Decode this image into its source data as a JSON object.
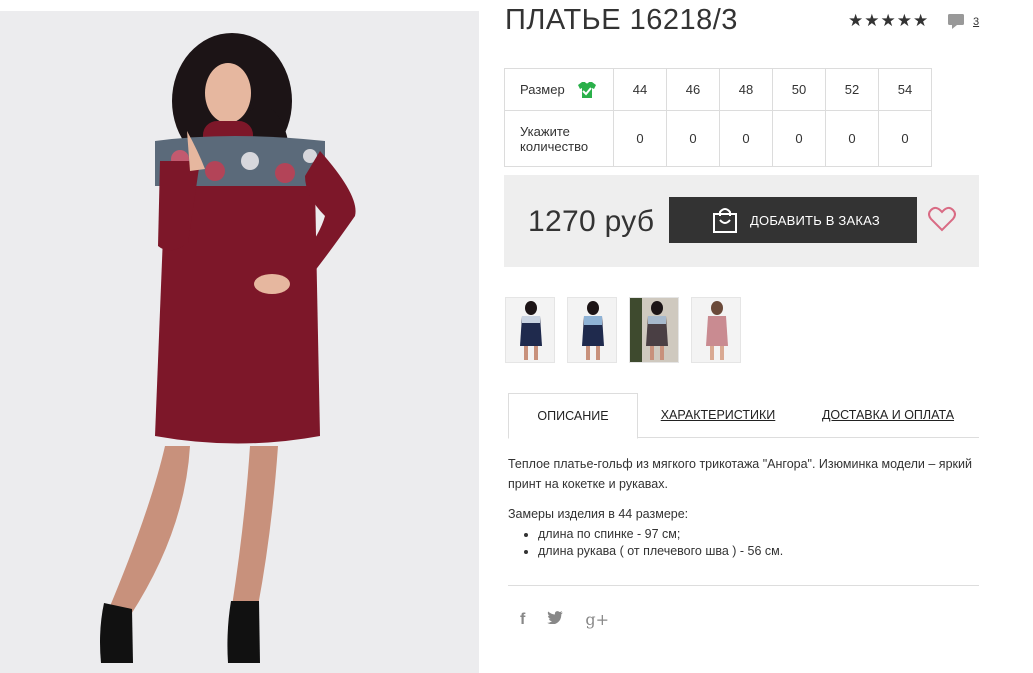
{
  "product": {
    "title": "ПЛАТЬЕ 16218/3",
    "rating_stars": 5,
    "rating_icon": "star-icon",
    "comments_count": "3"
  },
  "size_table": {
    "size_label": "Размер",
    "qty_label_1": "Укажите",
    "qty_label_2": "количество",
    "sizes": [
      "44",
      "46",
      "48",
      "50",
      "52",
      "54"
    ],
    "quantities": [
      "0",
      "0",
      "0",
      "0",
      "0",
      "0"
    ]
  },
  "price_box": {
    "price": "1270 руб",
    "order_button": "ДОБАВИТЬ В ЗАКАЗ"
  },
  "tabs": {
    "description": "ОПИСАНИЕ",
    "characteristics": "ХАРАКТЕРИСТИКИ",
    "delivery": "ДОСТАВКА И ОПЛАТА"
  },
  "description": {
    "text": "Теплое платье-гольф из мягкого трикотажа \"Ангора\". Изюминка модели – яркий принт на кокетке и рукавах.",
    "measure_title": "Замеры изделия в 44 размере:",
    "measures": [
      "длина по спинке - 97 см;",
      "длина рукава ( от плечевого шва ) - 56 см."
    ]
  },
  "social": {
    "facebook": "f",
    "twitter": "🐦",
    "google": "g+"
  },
  "colors": {
    "dress": "#7d1729",
    "dark": "#333333",
    "accent_pink": "#d96b84",
    "check_green": "#2ab04a",
    "panel": "#eeeeee"
  }
}
